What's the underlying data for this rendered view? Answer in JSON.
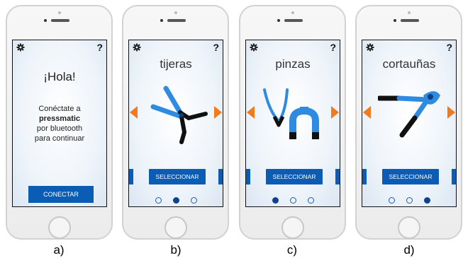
{
  "screens": [
    {
      "help_label": "?",
      "greeting": "¡Hola!",
      "message": [
        "Conéctate a",
        "pressmatic",
        "por bluetooth",
        "para continuar"
      ],
      "button_label": "CONECTAR",
      "caption": "a)"
    },
    {
      "help_label": "?",
      "title": "tijeras",
      "button_label": "SELECCIONAR",
      "tool_icon": "scissors-icon",
      "active_dot": 2,
      "dot_count": 3,
      "caption": "b)"
    },
    {
      "help_label": "?",
      "title": "pinzas",
      "button_label": "SELECCIONAR",
      "tool_icon": "tweezers-icon",
      "active_dot": 1,
      "dot_count": 3,
      "caption": "c)"
    },
    {
      "help_label": "?",
      "title": "cortauñas",
      "button_label": "SELECCIONAR",
      "tool_icon": "nail-clipper-icon",
      "active_dot": 3,
      "dot_count": 3,
      "caption": "d)"
    }
  ],
  "colors": {
    "accent_blue": "#0b5cb5",
    "arrow_orange": "#f07a1e",
    "tool_blue": "#2f8be0"
  }
}
